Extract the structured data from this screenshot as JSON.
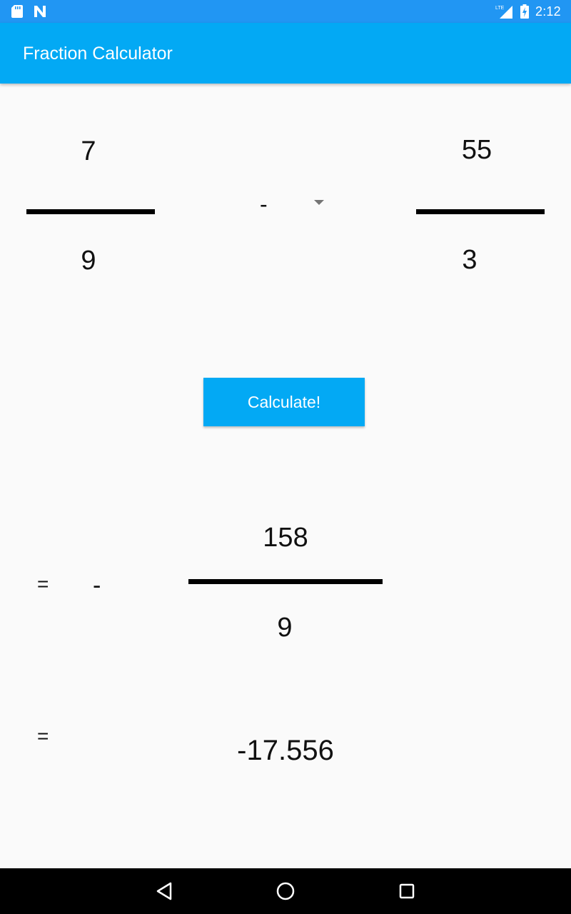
{
  "status_bar": {
    "time": "2:12",
    "network": "LTE",
    "icons": [
      "sd-card-icon",
      "n-notification-icon",
      "lte-signal-icon",
      "battery-charging-icon"
    ]
  },
  "app_bar": {
    "title": "Fraction Calculator"
  },
  "calculator": {
    "first_fraction": {
      "numerator": "7",
      "denominator": "9"
    },
    "operator": "-",
    "second_fraction": {
      "numerator": "55",
      "denominator": "3"
    },
    "calculate_label": "Calculate!"
  },
  "result": {
    "equals": "=",
    "sign": "-",
    "numerator": "158",
    "denominator": "9",
    "decimal_equals": "=",
    "decimal": "-17.556"
  },
  "colors": {
    "status_bar": "#2196f3",
    "app_bar": "#03a9f4",
    "button": "#03a9f4",
    "background": "#fafafa"
  },
  "nav_bar": {
    "icons": [
      "back-icon",
      "home-icon",
      "recents-icon"
    ]
  }
}
